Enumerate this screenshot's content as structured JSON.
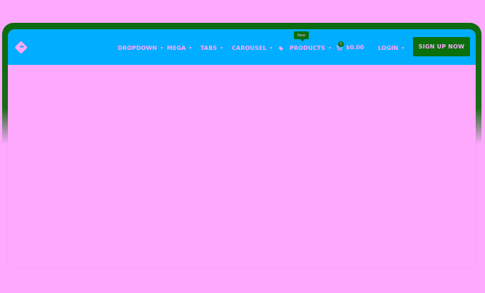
{
  "colors": {
    "navbar": "#00adfe",
    "accent": "#0b6f0b",
    "page": "#fea8fe"
  },
  "icons": {
    "logo": "diamond-logo-icon",
    "products": "tag-icon",
    "cart": "cart-icon",
    "dropdown": "chevron-down-icon"
  },
  "nav": {
    "items": [
      {
        "label": "DROPDOWN"
      },
      {
        "label": "MEGA"
      },
      {
        "label": "TABS"
      },
      {
        "label": "CAROUSEL"
      },
      {
        "label": "PRODUCTS"
      }
    ],
    "new_badge": "New",
    "cart": {
      "count": "0",
      "total": "$0.00"
    },
    "login": "LOGIN",
    "signup": "SIGN UP NOW"
  }
}
